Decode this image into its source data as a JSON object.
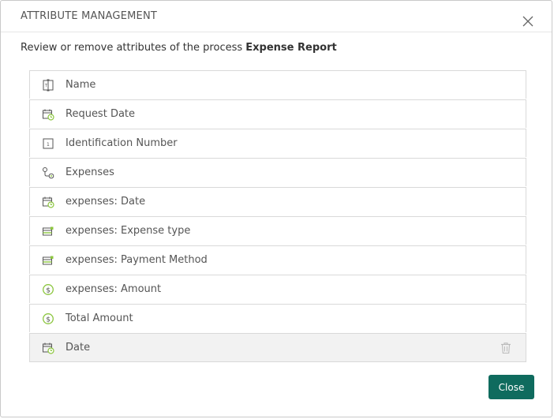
{
  "dialog": {
    "title": "ATTRIBUTE MANAGEMENT",
    "subtitle_prefix": "Review or remove attributes of the process ",
    "process_name": "Expense Report",
    "close_button_label": "Close"
  },
  "attributes": [
    {
      "label": "Name",
      "icon": "text-field-icon"
    },
    {
      "label": "Request Date",
      "icon": "calendar-clock-icon"
    },
    {
      "label": "Identification Number",
      "icon": "number-field-icon"
    },
    {
      "label": "Expenses",
      "icon": "link-collection-icon"
    },
    {
      "label": "expenses: Date",
      "icon": "calendar-clock-icon"
    },
    {
      "label": "expenses: Expense type",
      "icon": "list-field-icon"
    },
    {
      "label": "expenses: Payment Method",
      "icon": "list-field-icon"
    },
    {
      "label": "expenses: Amount",
      "icon": "currency-icon"
    },
    {
      "label": "Total Amount",
      "icon": "currency-icon"
    },
    {
      "label": "Date",
      "icon": "calendar-clock-icon",
      "hovered": true
    }
  ],
  "colors": {
    "primary_button": "#0f6b5e",
    "icon_accent": "#8cc63f",
    "icon_stroke": "#555555"
  }
}
